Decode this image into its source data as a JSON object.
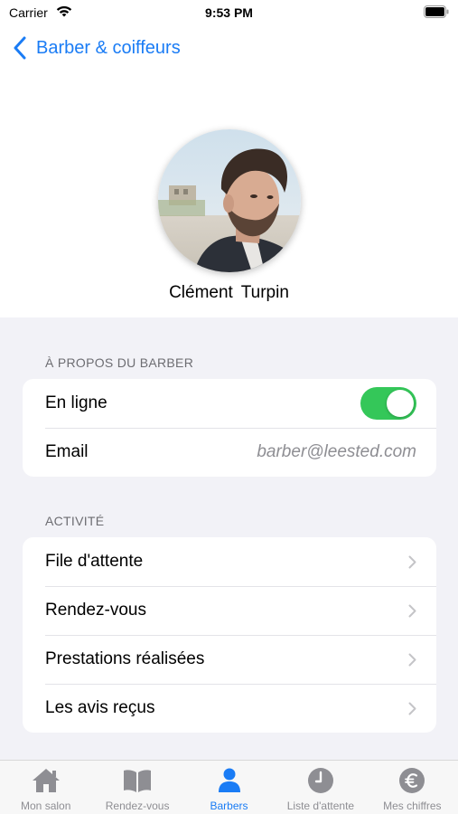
{
  "status_bar": {
    "carrier": "Carrier",
    "time": "9:53 PM"
  },
  "nav": {
    "back_label": "Barber & coiffeurs"
  },
  "profile": {
    "name": "Clément  Turpin"
  },
  "about": {
    "header": "À PROPOS DU BARBER",
    "online_label": "En ligne",
    "online": true,
    "email_label": "Email",
    "email_value": "barber@leested.com"
  },
  "activity": {
    "header": "ACTIVITÉ",
    "items": [
      {
        "label": "File d'attente"
      },
      {
        "label": "Rendez-vous"
      },
      {
        "label": "Prestations réalisées"
      },
      {
        "label": "Les avis reçus"
      }
    ]
  },
  "tabs": [
    {
      "label": "Mon salon",
      "icon": "house-icon"
    },
    {
      "label": "Rendez-vous",
      "icon": "book-icon"
    },
    {
      "label": "Barbers",
      "icon": "person-icon",
      "active": true
    },
    {
      "label": "Liste d'attente",
      "icon": "clock-icon"
    },
    {
      "label": "Mes chiffres",
      "icon": "euro-icon"
    }
  ],
  "colors": {
    "accent": "#1a7cf5",
    "toggle_on": "#34c759",
    "inactive_icon": "#8e8e93"
  }
}
